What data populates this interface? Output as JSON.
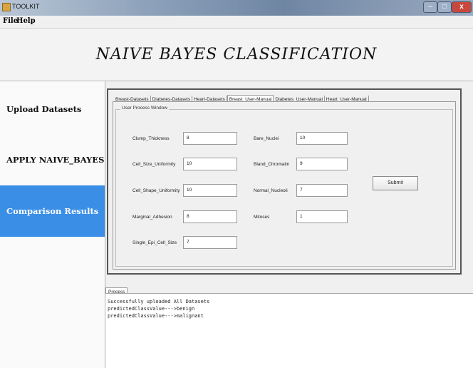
{
  "window": {
    "title": "TOOLKIT"
  },
  "menu": {
    "file": "File",
    "help": "Help"
  },
  "header": {
    "title": "NAIVE BAYES CLASSIFICATION"
  },
  "sidebar": {
    "items": [
      {
        "label": "Upload Datasets"
      },
      {
        "label": "APPLY NAIVE_BAYES"
      },
      {
        "label": "Comparison Results"
      }
    ],
    "selected_color": "#3a8ee6"
  },
  "tabs": [
    "Breast-Datasets",
    "Diabetes-Datasets",
    "Heart-Datasets",
    "Breast_User-Manual",
    "Diabetes_User-Manual",
    "Heart_User-Manual"
  ],
  "active_tab": "Breast_User-Manual",
  "form": {
    "group_label": "User Process Window",
    "left_fields": [
      {
        "label": "Clump_Thickness",
        "value": "8"
      },
      {
        "label": "Cell_Size_Uniformity",
        "value": "10"
      },
      {
        "label": "Cell_Shape_Uniformity",
        "value": "10"
      },
      {
        "label": "Marginal_Adhesion",
        "value": "8"
      },
      {
        "label": "Single_Epi_Cell_Size",
        "value": "7"
      }
    ],
    "right_fields": [
      {
        "label": "Bare_Nuclei",
        "value": "10"
      },
      {
        "label": "Bland_Chromatin",
        "value": "9"
      },
      {
        "label": "Normal_Nucleoli",
        "value": "7"
      },
      {
        "label": "Mitoses",
        "value": "1"
      }
    ],
    "submit_label": "Submit"
  },
  "process": {
    "tab_label": "Process",
    "lines": [
      "Successfully uploaded All Datasets",
      "predictedClassValue--->benign",
      "predictedClassValue--->malignant"
    ]
  }
}
